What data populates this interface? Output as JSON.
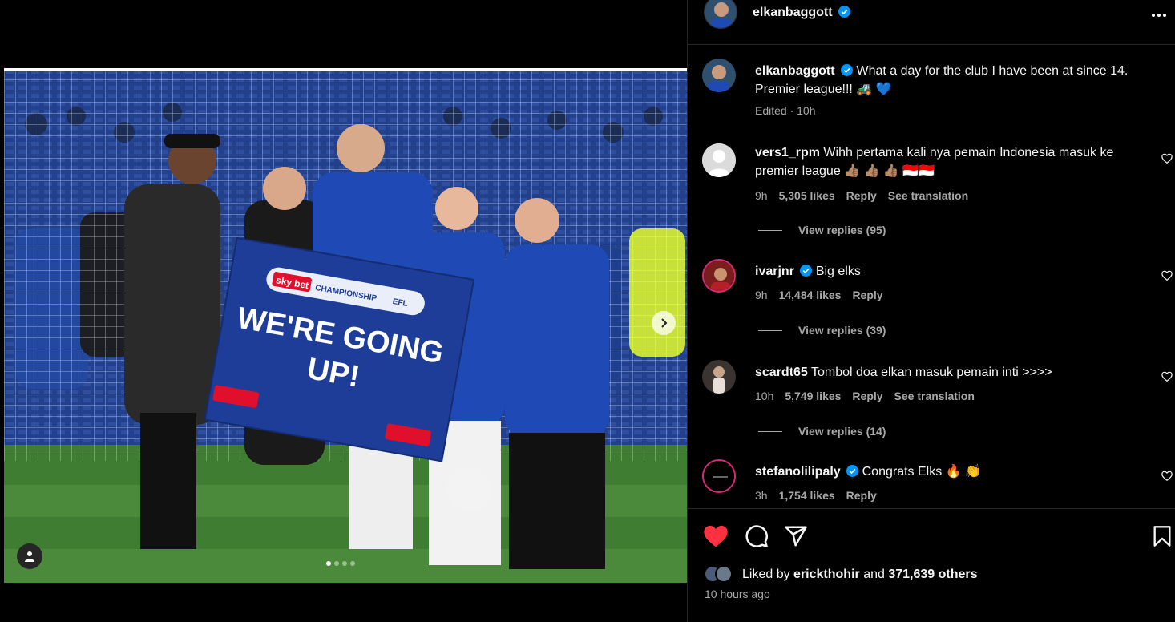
{
  "post": {
    "author": "elkanbaggott",
    "caption_user": "elkanbaggott",
    "caption_text": "What a day for the club I have been at since 14. Premier league!!! 🚜 💙",
    "caption_meta": "Edited · 10h",
    "banner": {
      "brand": "sky bet",
      "league": "CHAMPIONSHIP",
      "org": "EFL",
      "headline_1": "WE'RE GOING",
      "headline_2": "UP!"
    },
    "carousel": {
      "count": 4,
      "active": 0
    }
  },
  "comments": [
    {
      "user": "vers1_rpm",
      "verified": false,
      "text": "Wihh pertama kali nya pemain Indonesia masuk ke premier league 👍🏽 👍🏽 👍🏽 🇮🇩🇮🇩",
      "time": "9h",
      "likes": "5,305 likes",
      "reply": "Reply",
      "translate": "See translation",
      "view_replies": "View replies (95)"
    },
    {
      "user": "ivarjnr",
      "verified": true,
      "text": "Big elks",
      "time": "9h",
      "likes": "14,484 likes",
      "reply": "Reply",
      "translate": "",
      "view_replies": "View replies (39)"
    },
    {
      "user": "scardt65",
      "verified": false,
      "text": "Tombol doa elkan masuk pemain inti >>>>",
      "time": "10h",
      "likes": "5,749 likes",
      "reply": "Reply",
      "translate": "See translation",
      "view_replies": "View replies (14)"
    },
    {
      "user": "stefanolilipaly",
      "verified": true,
      "text": "Congrats Elks 🔥 👏",
      "time": "3h",
      "likes": "1,754 likes",
      "reply": "Reply",
      "translate": "",
      "view_replies": ""
    }
  ],
  "footer": {
    "liked_prefix": "Liked by",
    "liked_user": "erickthohir",
    "liked_and": "and",
    "liked_count": "371,639 others",
    "time_ago": "10 hours ago"
  },
  "icons": [
    "more-icon",
    "heart-icon",
    "comment-icon",
    "share-icon",
    "save-icon",
    "verified-icon",
    "next-arrow-icon",
    "user-tag-icon"
  ],
  "colors": {
    "verified": "#0095f6",
    "like_red": "#ff3040",
    "muted": "#a8a8a8",
    "ipswich_blue": "#1f49b5"
  }
}
